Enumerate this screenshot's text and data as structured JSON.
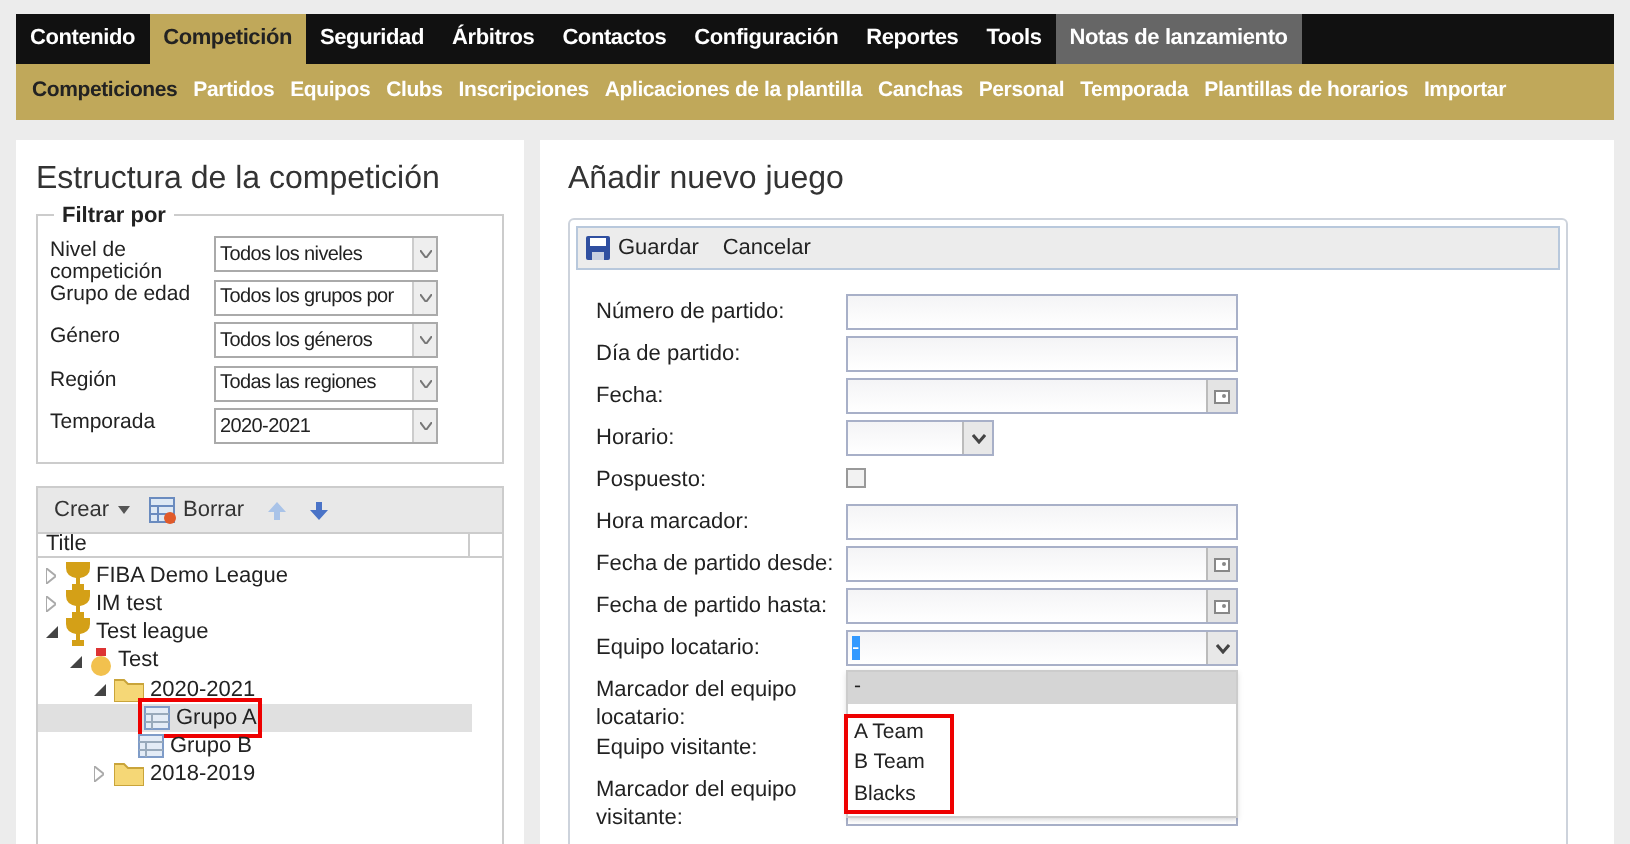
{
  "main_nav": [
    {
      "label": "Contenido",
      "selected": false
    },
    {
      "label": "Competición",
      "selected": true
    },
    {
      "label": "Seguridad",
      "selected": false
    },
    {
      "label": "Árbitros",
      "selected": false
    },
    {
      "label": "Contactos",
      "selected": false
    },
    {
      "label": "Configuración",
      "selected": false
    },
    {
      "label": "Reportes",
      "selected": false
    },
    {
      "label": "Tools",
      "selected": false
    },
    {
      "label": "Notas de lanzamiento",
      "selected": false,
      "kind": "special"
    }
  ],
  "sub_nav": [
    {
      "label": "Competiciones",
      "selected": true
    },
    {
      "label": "Partidos",
      "selected": false
    },
    {
      "label": "Equipos",
      "selected": false
    },
    {
      "label": "Clubs",
      "selected": false
    },
    {
      "label": "Inscripciones",
      "selected": false
    },
    {
      "label": "Aplicaciones de la plantilla",
      "selected": false
    },
    {
      "label": "Canchas",
      "selected": false
    },
    {
      "label": "Personal",
      "selected": false
    },
    {
      "label": "Temporada",
      "selected": false
    },
    {
      "label": "Plantillas de horarios",
      "selected": false
    },
    {
      "label": "Importar",
      "selected": false
    }
  ],
  "left_panel": {
    "title": "Estructura de la competición",
    "filter": {
      "legend": "Filtrar por",
      "rows": [
        {
          "label": "Nivel de competición",
          "value": "Todos los niveles"
        },
        {
          "label": "Grupo de edad",
          "value": "Todos los grupos por"
        },
        {
          "label": "Género",
          "value": "Todos los géneros"
        },
        {
          "label": "Región",
          "value": "Todas las regiones"
        },
        {
          "label": "Temporada",
          "value": "2020-2021"
        }
      ]
    },
    "tree": {
      "toolbar": {
        "create": "Crear",
        "delete": "Borrar"
      },
      "column": "Title",
      "items": [
        {
          "label": "FIBA Demo League",
          "kind": "league",
          "expanded": false,
          "selected": false,
          "highlighted": false
        },
        {
          "label": "IM test",
          "kind": "league",
          "expanded": false,
          "selected": false,
          "highlighted": false
        },
        {
          "label": "Test league",
          "kind": "league",
          "expanded": true,
          "selected": false,
          "highlighted": false,
          "children": [
            {
              "label": "Test",
              "kind": "competition",
              "expanded": true,
              "selected": false,
              "highlighted": false,
              "children": [
                {
                  "label": "2020-2021",
                  "kind": "season",
                  "expanded": true,
                  "selected": false,
                  "highlighted": false,
                  "children": [
                    {
                      "label": "Grupo A",
                      "kind": "group",
                      "selected": true,
                      "highlighted": true
                    },
                    {
                      "label": "Grupo B",
                      "kind": "group",
                      "selected": false,
                      "highlighted": false
                    }
                  ]
                },
                {
                  "label": "2018-2019",
                  "kind": "season",
                  "expanded": false,
                  "selected": false,
                  "highlighted": false
                }
              ]
            }
          ]
        }
      ]
    }
  },
  "right_panel": {
    "title": "Añadir nuevo juego",
    "toolbar": {
      "save": "Guardar",
      "cancel": "Cancelar"
    },
    "fields": [
      {
        "label": "Número de partido:",
        "kind": "text"
      },
      {
        "label": "Día de partido:",
        "kind": "text"
      },
      {
        "label": "Fecha:",
        "kind": "date"
      },
      {
        "label": "Horario:",
        "kind": "select"
      },
      {
        "label": "Pospuesto:",
        "kind": "checkbox",
        "checked": false
      },
      {
        "label": "Hora marcador:",
        "kind": "text"
      },
      {
        "label": "Fecha de partido desde:",
        "kind": "date"
      },
      {
        "label": "Fecha de partido hasta:",
        "kind": "date"
      },
      {
        "label": "Equipo locatario:",
        "kind": "combo",
        "value": "-",
        "dropdown": [
          {
            "label": "-",
            "selected": true,
            "highlighted": false
          },
          {
            "label": "A Team",
            "selected": false,
            "highlighted": true
          },
          {
            "label": "B Team",
            "selected": false,
            "highlighted": true
          },
          {
            "label": "Blacks",
            "selected": false,
            "highlighted": true
          }
        ]
      },
      {
        "label": "Marcador del equipo locatario:",
        "kind": "hidden"
      },
      {
        "label": "Equipo visitante:",
        "kind": "hidden"
      },
      {
        "label": "Marcador del equipo visitante:",
        "kind": "text"
      }
    ]
  }
}
